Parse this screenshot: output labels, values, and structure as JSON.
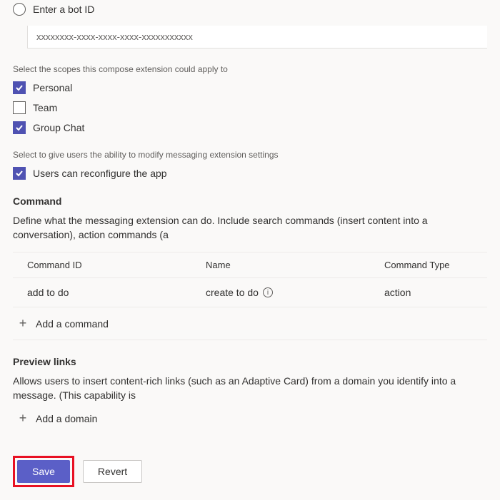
{
  "botId": {
    "radioLabel": "Enter a bot ID",
    "value": "xxxxxxxx-xxxx-xxxx-xxxx-xxxxxxxxxxx"
  },
  "scopes": {
    "label": "Select the scopes this compose extension could apply to",
    "items": [
      {
        "label": "Personal",
        "checked": true
      },
      {
        "label": "Team",
        "checked": false
      },
      {
        "label": "Group Chat",
        "checked": true
      }
    ]
  },
  "settings": {
    "label": "Select to give users the ability to modify messaging extension settings",
    "item": {
      "label": "Users can reconfigure the app",
      "checked": true
    }
  },
  "command": {
    "heading": "Command",
    "description": "Define what the messaging extension can do. Include search commands (insert content into a conversation), action commands (a",
    "columns": {
      "id": "Command ID",
      "name": "Name",
      "type": "Command Type"
    },
    "rows": [
      {
        "id": "add to do",
        "name": "create to do",
        "type": "action"
      }
    ],
    "addLabel": "Add a command"
  },
  "preview": {
    "heading": "Preview links",
    "description": "Allows users to insert content-rich links (such as an Adaptive Card) from a domain you identify into a message. (This capability is",
    "addLabel": "Add a domain"
  },
  "footer": {
    "save": "Save",
    "revert": "Revert"
  }
}
